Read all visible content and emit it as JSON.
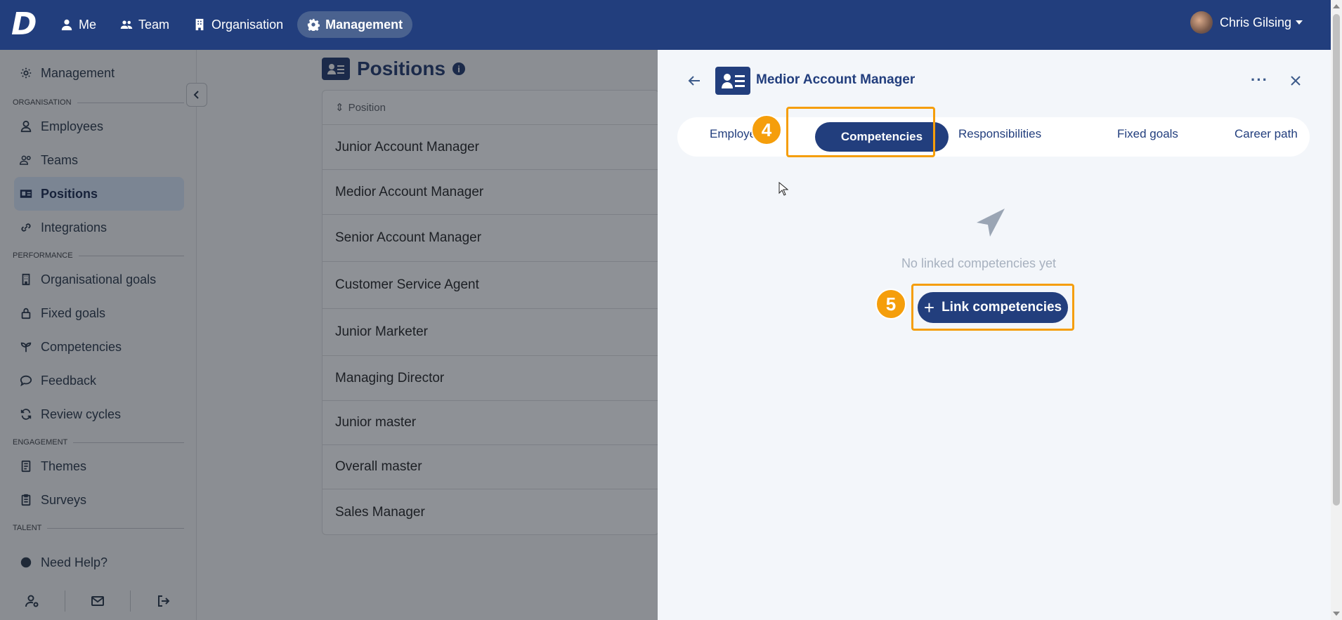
{
  "topbar": {
    "logo": "D",
    "nav": [
      {
        "label": "Me",
        "icon": "user-icon"
      },
      {
        "label": "Team",
        "icon": "users-icon"
      },
      {
        "label": "Organisation",
        "icon": "building-icon"
      },
      {
        "label": "Management",
        "icon": "gear-icon",
        "active": true
      }
    ],
    "user_name": "Chris Gilsing"
  },
  "sidebar": {
    "header": "Management",
    "sections": {
      "organisation": "ORGANISATION",
      "performance": "PERFORMANCE",
      "engagement": "ENGAGEMENT",
      "talent": "TALENT"
    },
    "items": {
      "employees": "Employees",
      "teams": "Teams",
      "positions": "Positions",
      "integrations": "Integrations",
      "organisational_goals": "Organisational goals",
      "fixed_goals": "Fixed goals",
      "competencies": "Competencies",
      "feedback": "Feedback",
      "review_cycles": "Review cycles",
      "themes": "Themes",
      "surveys": "Surveys"
    },
    "help": "Need Help?"
  },
  "main": {
    "title": "Positions",
    "column_header": "Position",
    "rows": [
      "Junior Account Manager",
      "Medior Account Manager",
      "Senior Account Manager",
      "Customer Service Agent",
      "Junior Marketer",
      "Managing Director",
      "Junior master",
      "Overall master",
      "Sales Manager"
    ]
  },
  "panel": {
    "title": "Medior Account Manager",
    "tabs": {
      "employees": "Employe",
      "competencies": "Competencies",
      "responsibilities": "Responsibilities",
      "fixed_goals": "Fixed goals",
      "career_path": "Career path"
    },
    "empty_text": "No linked competencies yet",
    "link_button": "Link competencies",
    "steps": {
      "tab_step": "4",
      "button_step": "5"
    }
  },
  "colors": {
    "brand": "#223e7d",
    "highlight": "#f59e0b",
    "panel_bg": "#f3f6fa"
  }
}
